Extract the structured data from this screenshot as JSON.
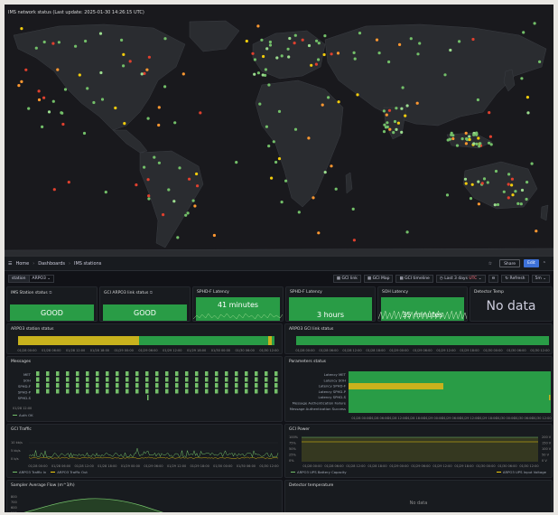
{
  "map": {
    "title": "IMS network status (Last update: 2025-01-30 14:26:15 UTC)"
  },
  "nav": {
    "breadcrumb_home": "Home",
    "breadcrumb_dashboards": "Dashboards",
    "breadcrumb_current": "IMS stations",
    "share_label": "Share",
    "edit_label": "Edit"
  },
  "variables": {
    "station_label": "station",
    "station_value": "ARPO3"
  },
  "toolbar": {
    "gci_link": "GCI link",
    "gci_map": "GCI Map",
    "gci_timeline": "GCI timeline",
    "time_range": "Last 3 days",
    "time_zone": "UTC",
    "refresh": "Refresh",
    "refresh_interval": "5m"
  },
  "stats": [
    {
      "title": "IMS Station status",
      "value": "GOOD"
    },
    {
      "title": "GCI ARPO3 link status",
      "value": "GOOD"
    },
    {
      "title": "SPHD-F Latency",
      "value": "41 minutes"
    },
    {
      "title": "SPHD-F Latency",
      "value": "3 hours"
    },
    {
      "title": "SOH Latency",
      "value": "35 minutes"
    },
    {
      "title": "Detector Temp",
      "value": "No data"
    }
  ],
  "timeline_panels": {
    "station_status_title": "ARPO3 station status",
    "gci_link_status_title": "ARPO3 GCI link status",
    "ticks": [
      "01/28 00:00",
      "01/28 06:00",
      "01/28 12:00",
      "01/28 18:00",
      "01/29 00:00",
      "01/29 06:00",
      "01/29 12:00",
      "01/29 18:00",
      "01/30 00:00",
      "01/30 06:00",
      "01/30 12:00"
    ]
  },
  "messages": {
    "title": "Messages",
    "rows": [
      "MET",
      "SOH",
      "SPHD-F",
      "SPHD-P",
      "SPHD-S"
    ],
    "tick_first": "01/28 12:00",
    "legend": "Auth OK"
  },
  "params": {
    "title": "Parameters status",
    "rows": [
      "Latency MET",
      "Latency SOH",
      "Latency SPHD-F",
      "Latency SPHD-P",
      "Latency SPHD-S",
      "Message Authentication Failure",
      "Message Authentication Success"
    ],
    "ticks": [
      "01/28 00:00",
      "01/28 06:00",
      "01/28 12:00",
      "01/28 18:00",
      "01/29 00:00",
      "01/29 06:00",
      "01/29 12:00",
      "01/29 18:00",
      "01/30 00:00",
      "01/30 06:00",
      "01/30 12:00"
    ]
  },
  "traffic": {
    "title": "GCI Traffic",
    "y_ticks": [
      "10 kb/s",
      "5 kb/s",
      "0 b/s"
    ],
    "ticks": [
      "01/28 00:00",
      "01/28 06:00",
      "01/28 12:00",
      "01/28 18:00",
      "01/29 00:00",
      "01/29 06:00",
      "01/29 12:00",
      "01/29 18:00",
      "01/30 00:00",
      "01/30 06:00",
      "01/30 12:00"
    ],
    "legend_in": "ARPO3 Traffic In",
    "legend_out": "ARPO3 Traffic Out"
  },
  "power": {
    "title": "GCI Power",
    "y_left": [
      "100%",
      "75%",
      "50%",
      "25%",
      "0%"
    ],
    "y_right": [
      "200 V",
      "150 V",
      "100 V",
      "50 V",
      "0 V"
    ],
    "ticks": [
      "01/28 00:00",
      "01/28 06:00",
      "01/28 12:00",
      "01/28 18:00",
      "01/29 00:00",
      "01/29 06:00",
      "01/29 12:00",
      "01/29 18:00",
      "01/30 00:00",
      "01/30 06:00",
      "01/30 12:00"
    ],
    "legend_battery": "ARPO3 UPS Battery Capacity",
    "legend_voltage": "ARPO3 UPS Input Voltage"
  },
  "flow": {
    "title": "Sampler Average Flow (m^3/h)",
    "y_ticks": [
      "800",
      "700",
      "600",
      "500"
    ]
  },
  "detector": {
    "title": "Detector temperature",
    "empty": "No data"
  },
  "colors": {
    "green": "#299c46",
    "green_light": "#73bf69",
    "yellow": "#c8b21d",
    "red": "#e0402e",
    "orange": "#ff9830",
    "panel_bg": "#181b1f",
    "page_bg": "#111217",
    "accent_blue": "#3d71d9"
  }
}
